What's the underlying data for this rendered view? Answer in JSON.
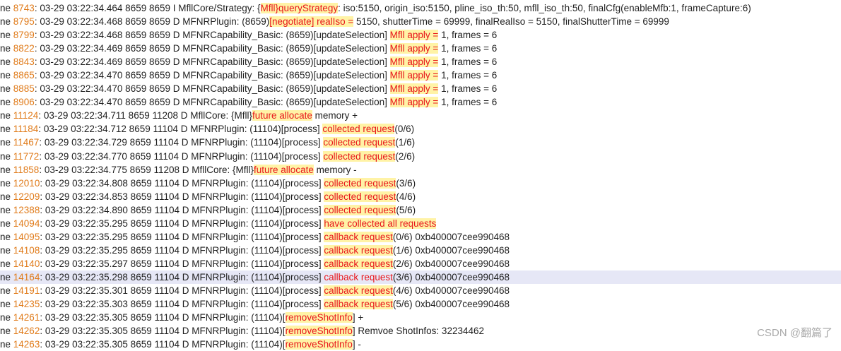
{
  "prefix": "ne ",
  "selected_line": "14164",
  "rows": [
    {
      "num": "8743",
      "segs": [
        {
          "t": ": 03-29 03:22:34.464  8659  8659 I MfllCore/Strategy: {"
        },
        {
          "t": "Mfll}queryStrategy",
          "c": "hl"
        },
        {
          "t": ": iso:5150, origin_iso:5150, pline_iso_th:50, mfll_iso_th:50, finalCfg(enableMfb:1, frameCapture:6)"
        }
      ]
    },
    {
      "num": "8795",
      "segs": [
        {
          "t": ": 03-29 03:22:34.468  8659  8659 D MFNRPlugin: (8659)"
        },
        {
          "t": "[negotiate] realIso =",
          "c": "hl"
        },
        {
          "t": " 5150, shutterTime = 69999, finalRealIso = 5150, finalShutterTime = 69999"
        }
      ]
    },
    {
      "num": "8799",
      "segs": [
        {
          "t": ": 03-29 03:22:34.468  8659  8659 D MFNRCapability_Basic: (8659)[updateSelection] "
        },
        {
          "t": "Mfll apply =",
          "c": "hl"
        },
        {
          "t": " 1, frames = 6"
        }
      ]
    },
    {
      "num": "8822",
      "segs": [
        {
          "t": ": 03-29 03:22:34.469  8659  8659 D MFNRCapability_Basic: (8659)[updateSelection] "
        },
        {
          "t": "Mfll apply =",
          "c": "hl"
        },
        {
          "t": " 1, frames = 6"
        }
      ]
    },
    {
      "num": "8843",
      "segs": [
        {
          "t": ": 03-29 03:22:34.469  8659  8659 D MFNRCapability_Basic: (8659)[updateSelection] "
        },
        {
          "t": "Mfll apply =",
          "c": "hl"
        },
        {
          "t": " 1, frames = 6"
        }
      ]
    },
    {
      "num": "8865",
      "segs": [
        {
          "t": ": 03-29 03:22:34.470  8659  8659 D MFNRCapability_Basic: (8659)[updateSelection] "
        },
        {
          "t": "Mfll apply =",
          "c": "hl"
        },
        {
          "t": " 1, frames = 6"
        }
      ]
    },
    {
      "num": "8885",
      "segs": [
        {
          "t": ": 03-29 03:22:34.470  8659  8659 D MFNRCapability_Basic: (8659)[updateSelection] "
        },
        {
          "t": "Mfll apply =",
          "c": "hl"
        },
        {
          "t": " 1, frames = 6"
        }
      ]
    },
    {
      "num": "8906",
      "segs": [
        {
          "t": ": 03-29 03:22:34.470  8659  8659 D MFNRCapability_Basic: (8659)[updateSelection] "
        },
        {
          "t": "Mfll apply =",
          "c": "hl"
        },
        {
          "t": " 1, frames = 6"
        }
      ]
    },
    {
      "num": "11124",
      "segs": [
        {
          "t": ": 03-29 03:22:34.711  8659 11208 D MfllCore: {Mfll}"
        },
        {
          "t": "future allocate",
          "c": "hl"
        },
        {
          "t": " memory +"
        }
      ]
    },
    {
      "num": "11184",
      "segs": [
        {
          "t": ": 03-29 03:22:34.712  8659 11104 D MFNRPlugin: (11104)[process] "
        },
        {
          "t": "collected request",
          "c": "hl"
        },
        {
          "t": "(0/6)"
        }
      ]
    },
    {
      "num": "11467",
      "segs": [
        {
          "t": ": 03-29 03:22:34.729  8659 11104 D MFNRPlugin: (11104)[process] "
        },
        {
          "t": "collected request",
          "c": "hl"
        },
        {
          "t": "(1/6)"
        }
      ]
    },
    {
      "num": "11772",
      "segs": [
        {
          "t": ": 03-29 03:22:34.770  8659 11104 D MFNRPlugin: (11104)[process] "
        },
        {
          "t": "collected request",
          "c": "hl"
        },
        {
          "t": "(2/6)"
        }
      ]
    },
    {
      "num": "11858",
      "segs": [
        {
          "t": ": 03-29 03:22:34.775  8659 11208 D MfllCore: {Mfll}"
        },
        {
          "t": "future allocate",
          "c": "hl"
        },
        {
          "t": " memory -"
        }
      ]
    },
    {
      "num": "12010",
      "segs": [
        {
          "t": ": 03-29 03:22:34.808  8659 11104 D MFNRPlugin: (11104)[process] "
        },
        {
          "t": "collected request",
          "c": "hl"
        },
        {
          "t": "(3/6)"
        }
      ]
    },
    {
      "num": "12209",
      "segs": [
        {
          "t": ": 03-29 03:22:34.853  8659 11104 D MFNRPlugin: (11104)[process] "
        },
        {
          "t": "collected request",
          "c": "hl"
        },
        {
          "t": "(4/6)"
        }
      ]
    },
    {
      "num": "12388",
      "segs": [
        {
          "t": ": 03-29 03:22:34.890  8659 11104 D MFNRPlugin: (11104)[process] "
        },
        {
          "t": "collected request",
          "c": "hl"
        },
        {
          "t": "(5/6)"
        }
      ]
    },
    {
      "num": "14094",
      "segs": [
        {
          "t": ": 03-29 03:22:35.295  8659 11104 D MFNRPlugin: (11104)[process] "
        },
        {
          "t": "have collected all requests",
          "c": "hl"
        }
      ]
    },
    {
      "num": "14095",
      "segs": [
        {
          "t": ": 03-29 03:22:35.295  8659 11104 D MFNRPlugin: (11104)[process] "
        },
        {
          "t": "callback request",
          "c": "hl"
        },
        {
          "t": "(0/6) 0xb400007cee990468"
        }
      ]
    },
    {
      "num": "14108",
      "segs": [
        {
          "t": ": 03-29 03:22:35.295  8659 11104 D MFNRPlugin: (11104)[process] "
        },
        {
          "t": "callback request",
          "c": "hl"
        },
        {
          "t": "(1/6) 0xb400007cee990468"
        }
      ]
    },
    {
      "num": "14140",
      "segs": [
        {
          "t": ": 03-29 03:22:35.297  8659 11104 D MFNRPlugin: (11104)[process] "
        },
        {
          "t": "callback request",
          "c": "hl"
        },
        {
          "t": "(2/6) 0xb400007cee990468"
        }
      ]
    },
    {
      "num": "14164",
      "segs": [
        {
          "t": ": 03-29 03:22:35.298  8659 11104 D MFNRPlugin: (11104)[process] "
        },
        {
          "t": "callback request",
          "c": "red"
        },
        {
          "t": "(3/6) 0xb400007cee990468"
        }
      ]
    },
    {
      "num": "14191",
      "segs": [
        {
          "t": ": 03-29 03:22:35.301  8659 11104 D MFNRPlugin: (11104)[process] "
        },
        {
          "t": "callback request",
          "c": "hl"
        },
        {
          "t": "(4/6) 0xb400007cee990468"
        }
      ]
    },
    {
      "num": "14235",
      "segs": [
        {
          "t": ": 03-29 03:22:35.303  8659 11104 D MFNRPlugin: (11104)[process] "
        },
        {
          "t": "callback request",
          "c": "hl"
        },
        {
          "t": "(5/6) 0xb400007cee990468"
        }
      ]
    },
    {
      "num": "14261",
      "segs": [
        {
          "t": ": 03-29 03:22:35.305  8659 11104 D MFNRPlugin: (11104)["
        },
        {
          "t": "removeShotInfo",
          "c": "hl"
        },
        {
          "t": "] +"
        }
      ]
    },
    {
      "num": "14262",
      "segs": [
        {
          "t": ": 03-29 03:22:35.305  8659 11104 D MFNRPlugin: (11104)["
        },
        {
          "t": "removeShotInfo",
          "c": "hl"
        },
        {
          "t": "] Remvoe ShotInfos: 32234462"
        }
      ]
    },
    {
      "num": "14263",
      "segs": [
        {
          "t": ": 03-29 03:22:35.305  8659 11104 D MFNRPlugin: (11104)["
        },
        {
          "t": "removeShotInfo",
          "c": "hl"
        },
        {
          "t": "] -"
        }
      ]
    }
  ],
  "watermark": "CSDN @翻篇了",
  "colors": {
    "line_number": "#e07b1a",
    "highlight_bg": "#fff3a6",
    "highlight_text": "#e8151b",
    "selected_row_bg": "#e6e7f6"
  }
}
